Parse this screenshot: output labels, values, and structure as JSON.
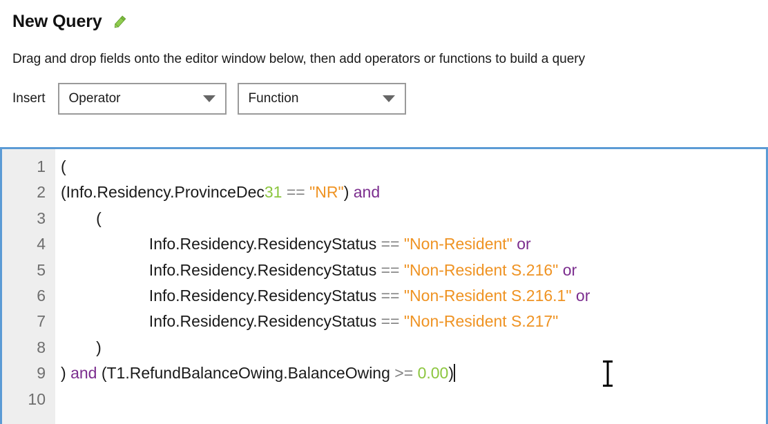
{
  "header": {
    "title": "New Query",
    "edit_icon": "pencil-icon"
  },
  "instruction": "Drag and drop fields onto the editor window below, then add operators or functions to build a query",
  "insert": {
    "label": "Insert",
    "operator_dropdown": {
      "value": "Operator",
      "arrow_icon": "chevron-down-icon"
    },
    "function_dropdown": {
      "value": "Function",
      "arrow_icon": "chevron-down-icon"
    }
  },
  "editor": {
    "border_color": "#5b9bd5",
    "gutter_bg": "#eeeeee",
    "line_number_color": "#6e6e6e",
    "syntax_colors": {
      "plain": "#1a1a1a",
      "number": "#8cc63f",
      "operator": "#808080",
      "string": "#ef9323",
      "keyword": "#7b2d8e"
    },
    "line_numbers": [
      "1",
      "2",
      "3",
      "4",
      "5",
      "6",
      "7",
      "8",
      "9",
      "10"
    ],
    "lines": [
      {
        "number": "1",
        "text": "(",
        "tokens": [
          {
            "t": "(",
            "c": "plain"
          }
        ]
      },
      {
        "number": "2",
        "text": "(Info.Residency.ProvinceDec31 == \"NR\") and",
        "tokens": [
          {
            "t": "(Info.Residency.ProvinceDec",
            "c": "plain"
          },
          {
            "t": "31",
            "c": "number"
          },
          {
            "t": " ",
            "c": "plain"
          },
          {
            "t": "==",
            "c": "operator"
          },
          {
            "t": " ",
            "c": "plain"
          },
          {
            "t": "\"NR\"",
            "c": "string"
          },
          {
            "t": ")",
            "c": "plain"
          },
          {
            "t": " ",
            "c": "plain"
          },
          {
            "t": "and",
            "c": "keyword"
          }
        ]
      },
      {
        "number": "3",
        "text": "        (",
        "tokens": [
          {
            "t": "        (",
            "c": "plain"
          }
        ]
      },
      {
        "number": "4",
        "text": "                    Info.Residency.ResidencyStatus == \"Non-Resident\" or",
        "tokens": [
          {
            "t": "                    Info.Residency.ResidencyStatus",
            "c": "plain"
          },
          {
            "t": " ",
            "c": "plain"
          },
          {
            "t": "==",
            "c": "operator"
          },
          {
            "t": " ",
            "c": "plain"
          },
          {
            "t": "\"Non-Resident\"",
            "c": "string"
          },
          {
            "t": " ",
            "c": "plain"
          },
          {
            "t": "or",
            "c": "keyword"
          }
        ]
      },
      {
        "number": "5",
        "text": "                    Info.Residency.ResidencyStatus == \"Non-Resident S.216\" or",
        "tokens": [
          {
            "t": "                    Info.Residency.ResidencyStatus",
            "c": "plain"
          },
          {
            "t": " ",
            "c": "plain"
          },
          {
            "t": "==",
            "c": "operator"
          },
          {
            "t": " ",
            "c": "plain"
          },
          {
            "t": "\"Non-Resident S.216\"",
            "c": "string"
          },
          {
            "t": " ",
            "c": "plain"
          },
          {
            "t": "or",
            "c": "keyword"
          }
        ]
      },
      {
        "number": "6",
        "text": "                    Info.Residency.ResidencyStatus == \"Non-Resident S.216.1\" or",
        "tokens": [
          {
            "t": "                    Info.Residency.ResidencyStatus",
            "c": "plain"
          },
          {
            "t": " ",
            "c": "plain"
          },
          {
            "t": "==",
            "c": "operator"
          },
          {
            "t": " ",
            "c": "plain"
          },
          {
            "t": "\"Non-Resident S.216.1\"",
            "c": "string"
          },
          {
            "t": " ",
            "c": "plain"
          },
          {
            "t": "or",
            "c": "keyword"
          }
        ]
      },
      {
        "number": "7",
        "text": "                    Info.Residency.ResidencyStatus == \"Non-Resident S.217\"",
        "tokens": [
          {
            "t": "                    Info.Residency.ResidencyStatus",
            "c": "plain"
          },
          {
            "t": " ",
            "c": "plain"
          },
          {
            "t": "==",
            "c": "operator"
          },
          {
            "t": " ",
            "c": "plain"
          },
          {
            "t": "\"Non-Resident S.217\"",
            "c": "string"
          }
        ]
      },
      {
        "number": "8",
        "text": "        )",
        "tokens": [
          {
            "t": "        )",
            "c": "plain"
          }
        ]
      },
      {
        "number": "9",
        "text": ") and (T1.RefundBalanceOwing.BalanceOwing >= 0.00)",
        "caret_at_end": true,
        "tokens": [
          {
            "t": ")",
            "c": "plain"
          },
          {
            "t": " ",
            "c": "plain"
          },
          {
            "t": "and",
            "c": "keyword"
          },
          {
            "t": " ",
            "c": "plain"
          },
          {
            "t": "(T1.RefundBalanceOwing.BalanceOwing",
            "c": "plain"
          },
          {
            "t": " ",
            "c": "plain"
          },
          {
            "t": ">=",
            "c": "operator"
          },
          {
            "t": " ",
            "c": "plain"
          },
          {
            "t": "0.00",
            "c": "number"
          },
          {
            "t": ")",
            "c": "plain"
          }
        ]
      },
      {
        "number": "10",
        "text": "",
        "tokens": []
      }
    ]
  },
  "mouse_cursor": {
    "type": "i-beam"
  }
}
